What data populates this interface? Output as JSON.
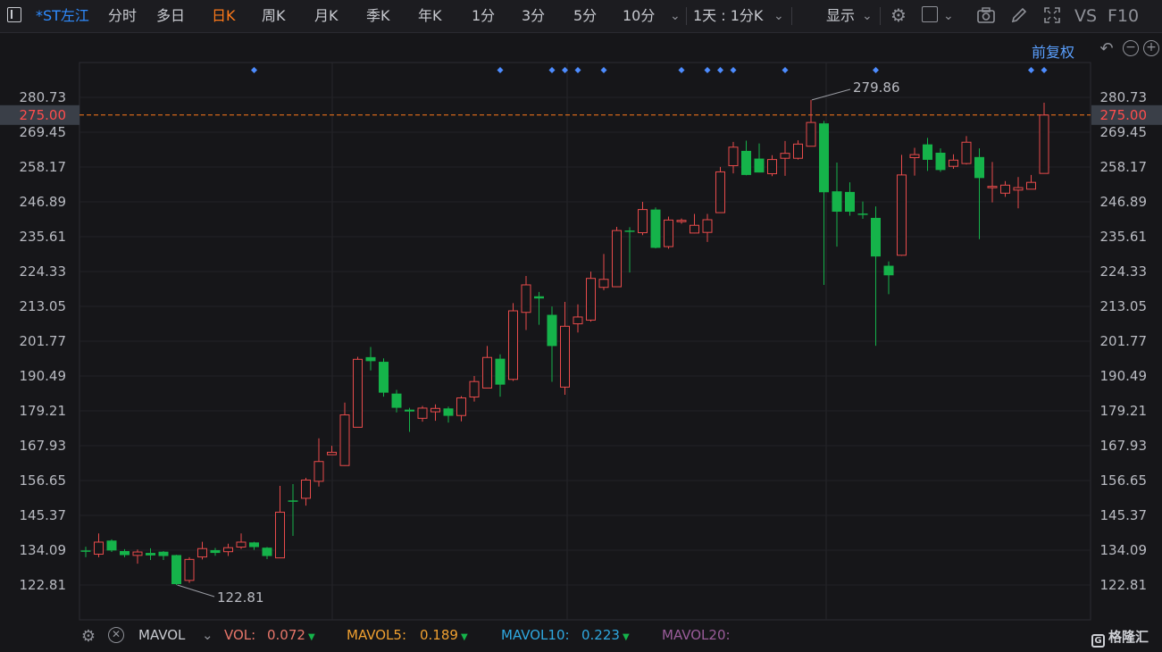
{
  "toolbar": {
    "symbol": "*ST左江",
    "periods": [
      "分时",
      "多日",
      "日K",
      "周K",
      "月K",
      "季K",
      "年K",
      "1分",
      "3分",
      "5分",
      "10分"
    ],
    "active_period": "日K",
    "combo": "1天 : 1分K",
    "display": "显示",
    "vs": "VS",
    "f10": "F10"
  },
  "adjust_label": "前复权",
  "accent_color": "#ff7a1a",
  "up_color": "#e84b4b",
  "down_color": "#15b34a",
  "marker_color": "#4d8cff",
  "chart_data": {
    "type": "candlestick",
    "y_ticks": [
      "280.73",
      "269.45",
      "258.17",
      "246.89",
      "235.61",
      "224.33",
      "213.05",
      "201.77",
      "190.49",
      "179.21",
      "167.93",
      "156.65",
      "145.37",
      "134.09",
      "122.81"
    ],
    "ylim": [
      117.17,
      285.1
    ],
    "current_price": "275.00",
    "max_label": "279.86",
    "min_label": "122.81",
    "event_marker_indices": [
      13,
      32,
      36,
      37,
      38,
      40,
      46,
      48,
      49,
      50,
      54,
      61,
      73,
      74
    ],
    "candles": [
      [
        134.0,
        133.8,
        135.2,
        131.8
      ],
      [
        132.8,
        136.7,
        139.5,
        131.8
      ],
      [
        137.2,
        134.0,
        137.6,
        133.5
      ],
      [
        133.8,
        132.5,
        134.4,
        131.8
      ],
      [
        132.4,
        133.5,
        134.3,
        129.7
      ],
      [
        133.2,
        132.4,
        134.7,
        130.9
      ],
      [
        133.6,
        132.2,
        133.8,
        130.9
      ],
      [
        132.5,
        123.1,
        132.6,
        122.8
      ],
      [
        124.3,
        131.1,
        131.8,
        123.5
      ],
      [
        131.9,
        134.6,
        136.8,
        131.1
      ],
      [
        134.1,
        133.2,
        134.8,
        132.3
      ],
      [
        133.6,
        134.9,
        136.2,
        132.2
      ],
      [
        135.1,
        136.7,
        139.5,
        134.5
      ],
      [
        136.6,
        135.1,
        136.8,
        134.2
      ],
      [
        134.9,
        132.2,
        135.1,
        131.2
      ],
      [
        131.6,
        146.4,
        154.9,
        131.6
      ],
      [
        150.2,
        149.8,
        155.5,
        138.7
      ],
      [
        150.9,
        156.8,
        157.5,
        148.5
      ],
      [
        156.4,
        162.8,
        170.3,
        154.7
      ],
      [
        165.0,
        165.8,
        167.9,
        164.9
      ],
      [
        161.5,
        177.9,
        181.9,
        161.4
      ],
      [
        173.9,
        195.9,
        196.7,
        173.9
      ],
      [
        196.6,
        195.3,
        199.9,
        192.3
      ],
      [
        195.1,
        185.1,
        196.2,
        183.8
      ],
      [
        184.8,
        180.2,
        186.0,
        178.7
      ],
      [
        179.6,
        179.0,
        180.2,
        172.4
      ],
      [
        176.8,
        180.1,
        180.8,
        175.7
      ],
      [
        178.9,
        180.0,
        181.3,
        176.0
      ],
      [
        180.0,
        177.6,
        180.6,
        175.4
      ],
      [
        177.7,
        183.4,
        184.0,
        175.8
      ],
      [
        183.7,
        188.7,
        190.5,
        182.2
      ],
      [
        186.6,
        196.5,
        200.2,
        186.6
      ],
      [
        196.1,
        187.7,
        197.5,
        183.8
      ],
      [
        189.4,
        211.6,
        214.1,
        188.9
      ],
      [
        211.1,
        220.0,
        222.9,
        205.4
      ],
      [
        216.3,
        215.6,
        217.7,
        207.1
      ],
      [
        210.3,
        200.2,
        213.0,
        188.6
      ],
      [
        186.9,
        206.6,
        214.5,
        184.4
      ],
      [
        207.4,
        209.6,
        213.7,
        204.6
      ],
      [
        208.6,
        222.1,
        224.3,
        208.1
      ],
      [
        219.2,
        221.8,
        230.0,
        218.3
      ],
      [
        219.4,
        237.6,
        238.8,
        219.4
      ],
      [
        237.6,
        237.4,
        238.7,
        224.0
      ],
      [
        236.9,
        244.4,
        246.9,
        236.1
      ],
      [
        244.4,
        232.0,
        245.1,
        231.8
      ],
      [
        232.4,
        241.0,
        242.1,
        231.7
      ],
      [
        240.8,
        240.9,
        241.5,
        239.8
      ],
      [
        236.8,
        239.3,
        243.0,
        236.7
      ],
      [
        237.0,
        241.1,
        243.0,
        233.9
      ],
      [
        243.4,
        256.6,
        258.2,
        243.4
      ],
      [
        258.6,
        264.6,
        266.3,
        256.1
      ],
      [
        263.4,
        255.6,
        266.7,
        255.5
      ],
      [
        260.9,
        256.4,
        265.8,
        256.4
      ],
      [
        256.0,
        260.6,
        262.0,
        255.2
      ],
      [
        261.0,
        262.6,
        266.6,
        255.3
      ],
      [
        261.0,
        265.6,
        266.8,
        260.6
      ],
      [
        264.9,
        272.6,
        279.9,
        264.9
      ],
      [
        272.3,
        250.0,
        273.1,
        220.0
      ],
      [
        250.3,
        243.7,
        259.6,
        232.4
      ],
      [
        250.1,
        243.7,
        253.2,
        242.4
      ],
      [
        243.1,
        242.8,
        247.0,
        241.4
      ],
      [
        241.7,
        229.2,
        245.4,
        200.3
      ],
      [
        226.2,
        223.1,
        227.6,
        217.0
      ],
      [
        229.6,
        255.6,
        262.1,
        229.4
      ],
      [
        261.2,
        262.2,
        264.4,
        255.4
      ],
      [
        265.5,
        260.5,
        267.6,
        256.9
      ],
      [
        262.8,
        257.2,
        264.2,
        256.6
      ],
      [
        258.4,
        260.4,
        262.3,
        257.6
      ],
      [
        259.3,
        266.2,
        268.2,
        259.0
      ],
      [
        261.4,
        254.6,
        264.2,
        234.8
      ],
      [
        251.7,
        251.9,
        259.8,
        246.7
      ],
      [
        249.7,
        252.3,
        253.6,
        248.5
      ],
      [
        250.7,
        251.5,
        254.9,
        244.8
      ],
      [
        251.0,
        253.2,
        255.6,
        251.0
      ],
      [
        256.1,
        275.0,
        279.0,
        256.1
      ]
    ]
  },
  "bottom": {
    "indicator": "MAVOL",
    "vol_label": "VOL:",
    "vol_value": "0.072",
    "mavol5_label": "MAVOL5:",
    "mavol5_value": "0.189",
    "mavol10_label": "MAVOL10:",
    "mavol10_value": "0.223",
    "mavol20_label": "MAVOL20:",
    "vol_color": "#e8766a",
    "mavol5_color": "#f0a030",
    "mavol10_color": "#2fa8e0",
    "mavol20_color": "#9a5c9a"
  },
  "watermark": "格隆汇"
}
